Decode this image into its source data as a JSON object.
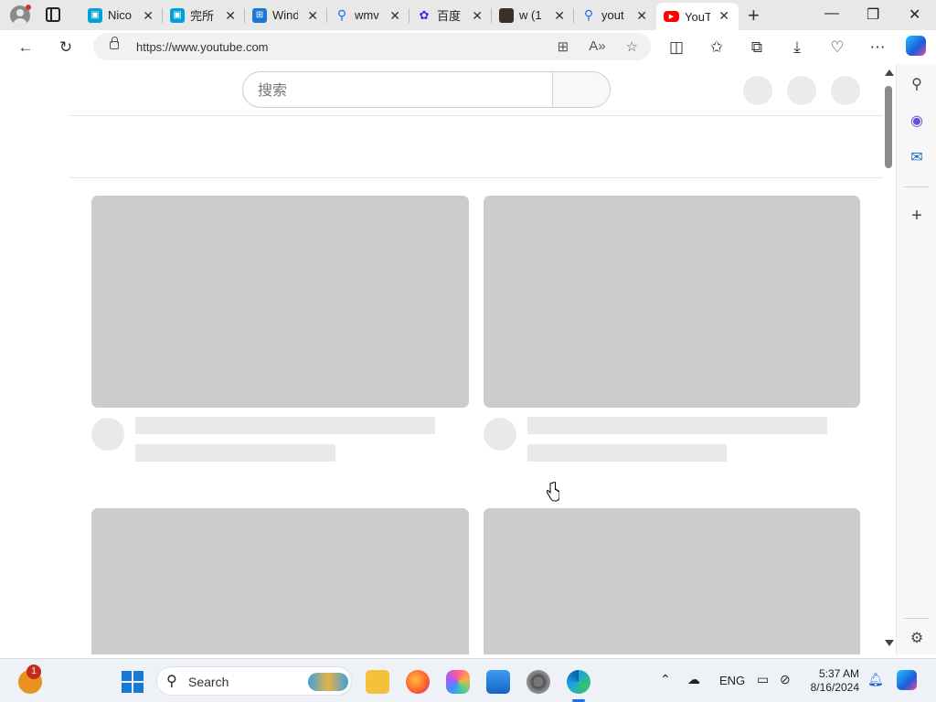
{
  "browser": {
    "tabs": [
      {
        "label": "Nico",
        "favicon": "bilibili-icon",
        "color": "#00a1d6"
      },
      {
        "label": "完所",
        "favicon": "bilibili-icon",
        "color": "#00a1d6"
      },
      {
        "label": "Wind",
        "favicon": "windows-icon",
        "color": "#1979d4"
      },
      {
        "label": "wmv",
        "favicon": "search-icon",
        "color": "#1a73e8"
      },
      {
        "label": "百度",
        "favicon": "baidu-icon",
        "color": "#2932e1"
      },
      {
        "label": "w (1",
        "favicon": "image-icon",
        "color": "#3a3025"
      },
      {
        "label": "yout",
        "favicon": "search-icon",
        "color": "#1a73e8"
      },
      {
        "label": "YouT",
        "favicon": "youtube-icon",
        "color": "#ff0000"
      }
    ],
    "active_tab_index": 7,
    "url": "https://www.youtube.com",
    "new_tab_glyph": "+",
    "window_controls": {
      "minimize": "—",
      "restore": "❐",
      "close": "✕"
    }
  },
  "page": {
    "search_placeholder": "搜索"
  },
  "taskbar": {
    "search_label": "Search",
    "language": "ENG",
    "time": "5:37 AM",
    "date": "8/16/2024",
    "notification_count": "1"
  }
}
